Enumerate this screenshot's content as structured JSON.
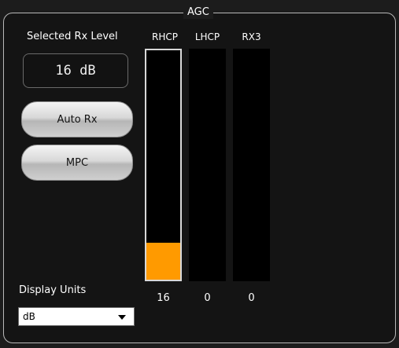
{
  "panel": {
    "group_title": "AGC",
    "rx_level_label": "Selected Rx Level",
    "rx_level_value": "16 dB",
    "buttons": {
      "auto_rx": "Auto Rx",
      "mpc": "MPC"
    },
    "display_units_label": "Display Units",
    "display_units_value": "dB"
  },
  "meters": [
    {
      "label": "RHCP",
      "value": "16",
      "level_fraction": 0.16,
      "selected": true
    },
    {
      "label": "LHCP",
      "value": "0",
      "level_fraction": 0.0,
      "selected": false
    },
    {
      "label": "RX3",
      "value": "0",
      "level_fraction": 0.0,
      "selected": false
    }
  ],
  "colors": {
    "meter_fill": "#ff9a00",
    "meter_background": "#000000",
    "panel_background": "#141414"
  }
}
